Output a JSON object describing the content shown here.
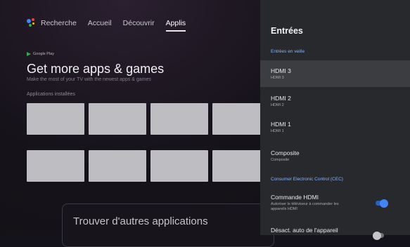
{
  "nav": {
    "items": [
      {
        "label": "Recherche"
      },
      {
        "label": "Accueil"
      },
      {
        "label": "Découvrir"
      },
      {
        "label": "Applis"
      }
    ]
  },
  "store": {
    "badge": "Google Play",
    "headline": "Get more apps & games",
    "subline": "Make the most of your TV with the newest apps & games"
  },
  "apps": {
    "section_title": "Applications installées",
    "more_card": "Trouver d'autres applications"
  },
  "panel": {
    "title": "Entrées",
    "section_standby": "Entrées en veille",
    "inputs": [
      {
        "title": "HDMI 3",
        "subtitle": "HDMI 3"
      },
      {
        "title": "HDMI 2",
        "subtitle": "HDMI 2"
      },
      {
        "title": "HDMI 1",
        "subtitle": "HDMI 1"
      },
      {
        "title": "Composite",
        "subtitle": "Composite"
      }
    ],
    "section_cec": "Consumer Electronic Control (CEC)",
    "cec_items": [
      {
        "title": "Commande HDMI",
        "subtitle_line1": "Autoriser le téléviseur à commander les",
        "subtitle_line2": "appareils HDMI",
        "on": true
      },
      {
        "title": "Désact. auto de l'appareil",
        "on": false
      }
    ]
  },
  "colors": {
    "accent_blue": "#8ab4f8",
    "toggle_on": "#4285f4",
    "panel_bg": "#27292c"
  }
}
